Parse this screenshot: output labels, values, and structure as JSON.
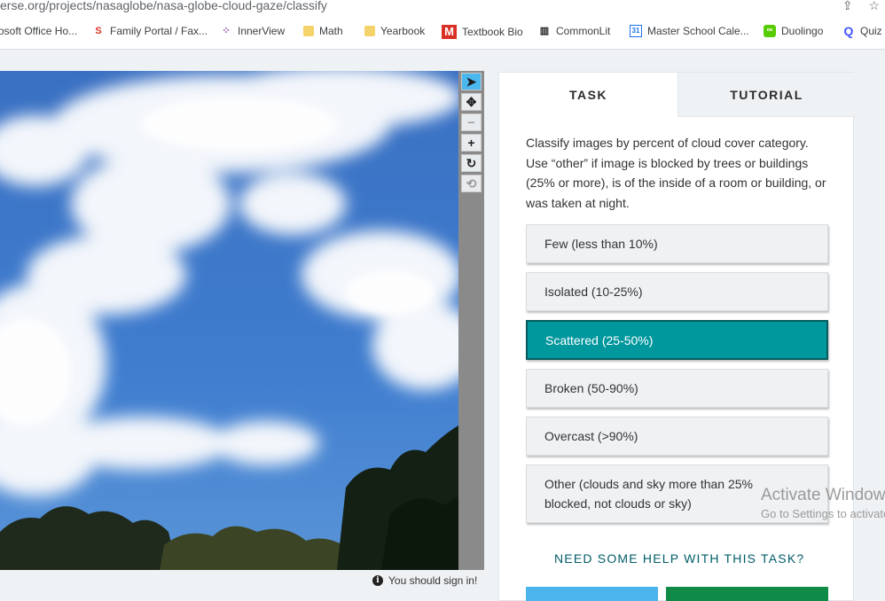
{
  "browser": {
    "url": "erse.org/projects/nasaglobe/nasa-globe-cloud-gaze/classify",
    "bookmarks": [
      {
        "label": "osoft Office Ho...",
        "icon": "office-icon"
      },
      {
        "label": "Family Portal / Fax...",
        "icon": "family-portal-icon",
        "color": "#d93025"
      },
      {
        "label": "InnerView",
        "icon": "innerview-icon",
        "color": "#8e44ad"
      },
      {
        "label": "Math",
        "icon": "folder-icon",
        "color": "#f5c542"
      },
      {
        "label": "Yearbook",
        "icon": "folder-icon",
        "color": "#f5c542"
      },
      {
        "label": "Textbook Bio",
        "icon": "gmail-icon",
        "color": "#d93025"
      },
      {
        "label": "CommonLit",
        "icon": "book-icon",
        "color": "#222222"
      },
      {
        "label": "Master School Cale...",
        "icon": "calendar-icon",
        "color": "#1a73e8"
      },
      {
        "label": "Duolingo",
        "icon": "duolingo-icon",
        "color": "#58cc02"
      },
      {
        "label": "Quiz",
        "icon": "quizlet-icon",
        "color": "#4255ff"
      }
    ]
  },
  "toolbar": {
    "tools": [
      {
        "name": "pointer",
        "icon": "cursor-icon"
      },
      {
        "name": "move",
        "icon": "move-icon"
      },
      {
        "name": "zoom-out",
        "icon": "minus-icon"
      },
      {
        "name": "zoom-in",
        "icon": "plus-icon"
      },
      {
        "name": "rotate",
        "icon": "rotate-icon"
      },
      {
        "name": "reset",
        "icon": "reset-icon"
      }
    ]
  },
  "signin_notice": "You should sign in!",
  "panel": {
    "tabs": {
      "task": "TASK",
      "tutorial": "TUTORIAL"
    },
    "instruction": "Classify images by percent of cloud cover category. Use “other” if image is blocked by trees or buildings (25% or more), is of the inside of a room or building, or was taken at night.",
    "answers": [
      {
        "label": "Few (less than 10%)",
        "selected": false
      },
      {
        "label": "Isolated (10-25%)",
        "selected": false
      },
      {
        "label": "Scattered (25-50%)",
        "selected": true
      },
      {
        "label": "Broken (50-90%)",
        "selected": false
      },
      {
        "label": "Overcast (>90%)",
        "selected": false
      },
      {
        "label": "Other (clouds and sky more than 25% blocked, not clouds or sky)",
        "selected": false
      }
    ],
    "help_link": "NEED SOME HELP WITH THIS TASK?"
  },
  "watermark": {
    "line1": "Activate Windows",
    "line2": "Go to Settings to activate Windows."
  },
  "colors": {
    "accent": "#00979d",
    "help_text": "#005d69",
    "done_button": "#4cb4ec",
    "next_button": "#0f8a47"
  }
}
